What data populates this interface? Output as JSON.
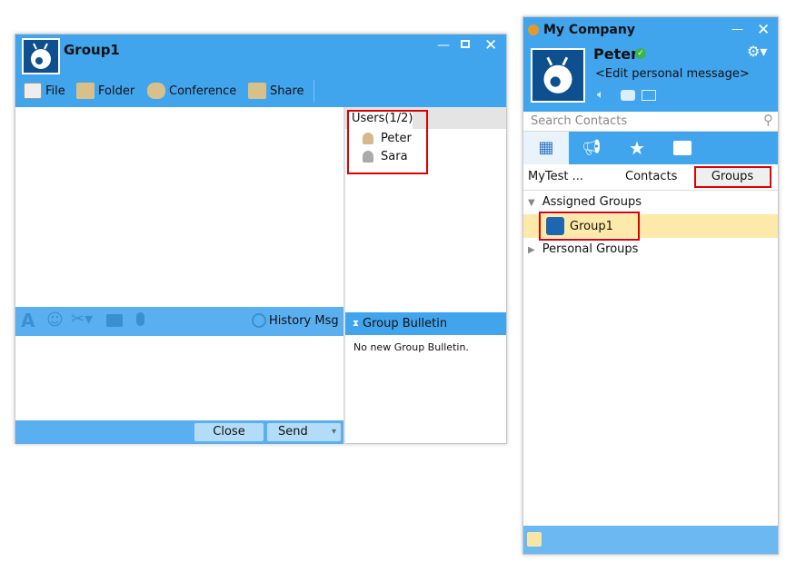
{
  "chat_window": {
    "title": "Group1",
    "toolbar": [
      {
        "label": "File",
        "icon": "file-icon"
      },
      {
        "label": "Folder",
        "icon": "folder-icon"
      },
      {
        "label": "Conference",
        "icon": "conference-icon"
      },
      {
        "label": "Share",
        "icon": "share-icon"
      }
    ],
    "users_tab": "Users(1/2)",
    "users": [
      "Peter",
      "Sara"
    ],
    "history_label": "History Msg",
    "bulletin_title": "Group Bulletin",
    "bulletin_text": "No new Group Bulletin.",
    "close_label": "Close",
    "send_label": "Send"
  },
  "main_window": {
    "title": "My Company",
    "user_name": "Peter",
    "status": "online",
    "personal_message": "<Edit personal message>",
    "search_placeholder": "Search Contacts",
    "subtabs": [
      "MyTest ...",
      "Contacts",
      "Groups"
    ],
    "tree": {
      "assigned": "Assigned Groups",
      "group": "Group1",
      "personal": "Personal Groups"
    }
  },
  "colors": {
    "accent": "#41a5ee",
    "selected_row": "#fde9a9",
    "highlight": "#e00000"
  }
}
